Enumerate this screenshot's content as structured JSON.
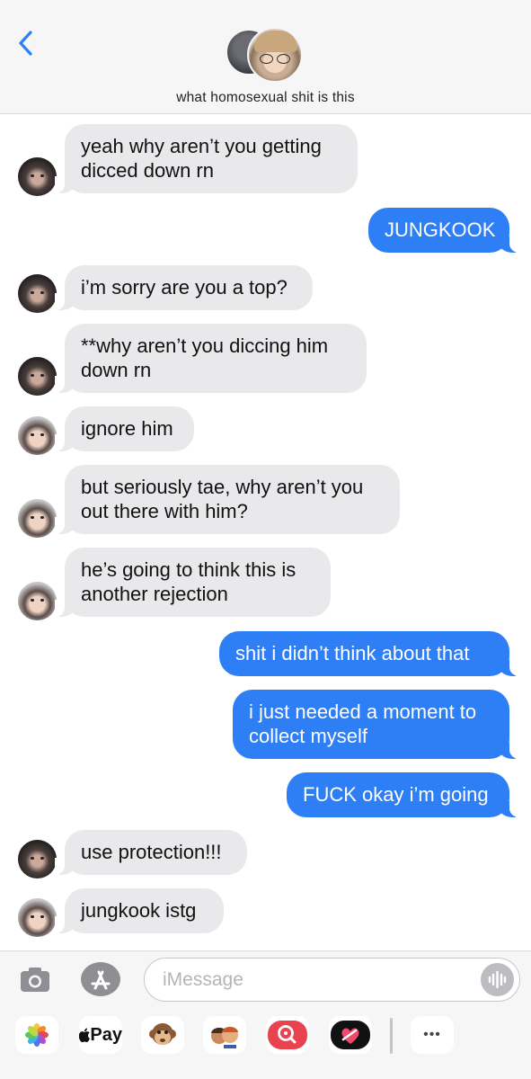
{
  "header": {
    "back_icon": "chevron-left-icon",
    "group_name": "what homosexual shit is this"
  },
  "messages": [
    {
      "dir": "in",
      "sender_avatar": "dark",
      "text": "yeah why aren’t you getting\ndicced down rn"
    },
    {
      "dir": "out",
      "text": "JUNGKOOK"
    },
    {
      "dir": "in",
      "sender_avatar": "dark",
      "text": "i’m sorry are you a top?"
    },
    {
      "dir": "in",
      "sender_avatar": "dark",
      "text": "**why aren’t you diccing him\ndown rn"
    },
    {
      "dir": "in",
      "sender_avatar": "light",
      "text": "ignore him"
    },
    {
      "dir": "in",
      "sender_avatar": "light",
      "text": "but seriously tae, why aren’t you\nout there with him?"
    },
    {
      "dir": "in",
      "sender_avatar": "light",
      "text": "he’s going to think this is\nanother rejection"
    },
    {
      "dir": "out",
      "text": "shit i didn’t think about that"
    },
    {
      "dir": "out",
      "text": "i just needed a moment to\ncollect myself"
    },
    {
      "dir": "out",
      "text": "FUCK okay i’m going"
    },
    {
      "dir": "in",
      "sender_avatar": "dark",
      "text": "use protection!!!"
    },
    {
      "dir": "in",
      "sender_avatar": "light",
      "text": "jungkook istg"
    }
  ],
  "composer": {
    "placeholder": "iMessage",
    "camera_icon": "camera-icon",
    "appstore_icon": "app-store-icon",
    "mic_icon": "audio-waveform-icon"
  },
  "app_drawer": {
    "items": [
      "photos-icon",
      "apple-pay-icon",
      "monkey-emoji-icon",
      "memoji-icon",
      "image-search-icon",
      "digital-touch-icon",
      "more-icon"
    ],
    "apple_pay_label": "Pay",
    "more_label": "•••"
  },
  "colors": {
    "outgoing_bubble": "#2e7ff6",
    "incoming_bubble": "#e9e9eb",
    "header_bg": "#f6f6f7"
  }
}
